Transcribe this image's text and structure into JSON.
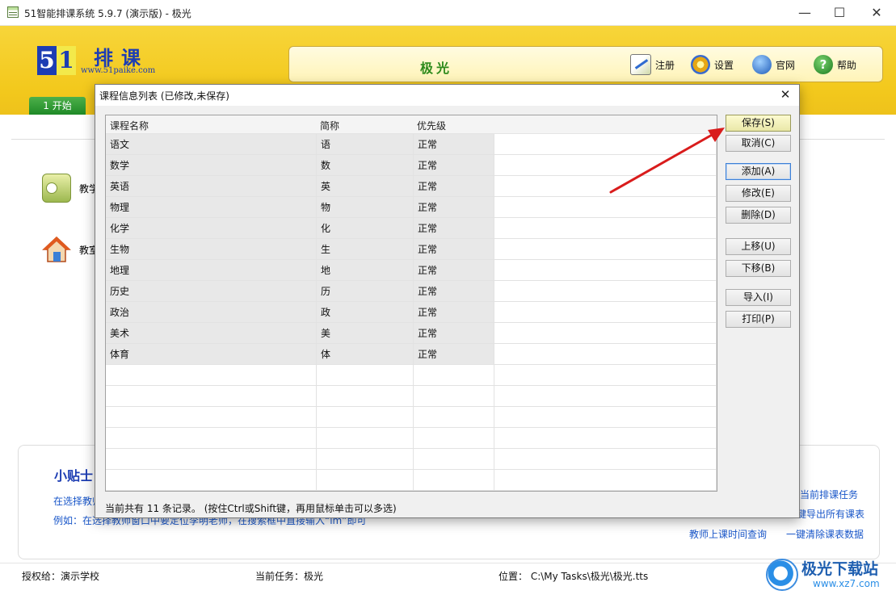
{
  "window": {
    "title": "51智能排课系统 5.9.7 (演示版) - 极光",
    "minimize": "—",
    "maximize": "☐",
    "close": "✕"
  },
  "header": {
    "logo_digit_5": "5",
    "logo_digit_1": "1",
    "logo_text": "排课",
    "logo_url": "www.51paike.com",
    "school_name": "极光",
    "buttons": {
      "register": "注册",
      "settings": "设置",
      "website": "官网",
      "help": "帮助"
    },
    "help_glyph": "?",
    "tab_start": "1 开始"
  },
  "sidebar": {
    "teacher_label": "教学",
    "classroom_label": "教室"
  },
  "tips": {
    "title": "小贴士",
    "line1": "在选择教师",
    "line2": "例如：在选择教师窗口中要定位李明老师，在搜索框中直接输入“lm”即可"
  },
  "right_links": {
    "link1": "给当前排课任务",
    "link2": "一键导出所有课表",
    "link3": "教师上课时间查询",
    "link4": "一键清除课表数据"
  },
  "statusbar": {
    "licensed": "授权给：演示学校",
    "task": "当前任务：极光",
    "location": "位置：  C:\\My Tasks\\极光\\极光.tts"
  },
  "watermark": {
    "title": "极光下载站",
    "url": "www.xz7.com"
  },
  "dialog": {
    "title": "课程信息列表 (已修改,未保存)",
    "close": "✕",
    "columns": [
      "课程名称",
      "简称",
      "优先级"
    ],
    "rows": [
      {
        "name": "语文",
        "short": "语",
        "priority": "正常"
      },
      {
        "name": "数学",
        "short": "数",
        "priority": "正常"
      },
      {
        "name": "英语",
        "short": "英",
        "priority": "正常"
      },
      {
        "name": "物理",
        "short": "物",
        "priority": "正常"
      },
      {
        "name": "化学",
        "short": "化",
        "priority": "正常"
      },
      {
        "name": "生物",
        "short": "生",
        "priority": "正常"
      },
      {
        "name": "地理",
        "short": "地",
        "priority": "正常"
      },
      {
        "name": "历史",
        "short": "历",
        "priority": "正常"
      },
      {
        "name": "政治",
        "short": "政",
        "priority": "正常"
      },
      {
        "name": "美术",
        "short": "美",
        "priority": "正常"
      },
      {
        "name": "体育",
        "short": "体",
        "priority": "正常"
      }
    ],
    "buttons": {
      "save": "保存(S)",
      "cancel": "取消(C)",
      "add": "添加(A)",
      "edit": "修改(E)",
      "delete": "删除(D)",
      "move_up": "上移(U)",
      "move_down": "下移(B)",
      "import": "导入(I)",
      "print": "打印(P)"
    },
    "status": "当前共有 11 条记录。 (按住Ctrl或Shift键，再用鼠标单击可以多选)"
  },
  "colors": {
    "header_yellow": "#f3c91d",
    "brand_blue": "#1d3db3",
    "school_green": "#2e8b1c",
    "link_blue": "#1a57c9",
    "annotation_red": "#d91c1c"
  }
}
